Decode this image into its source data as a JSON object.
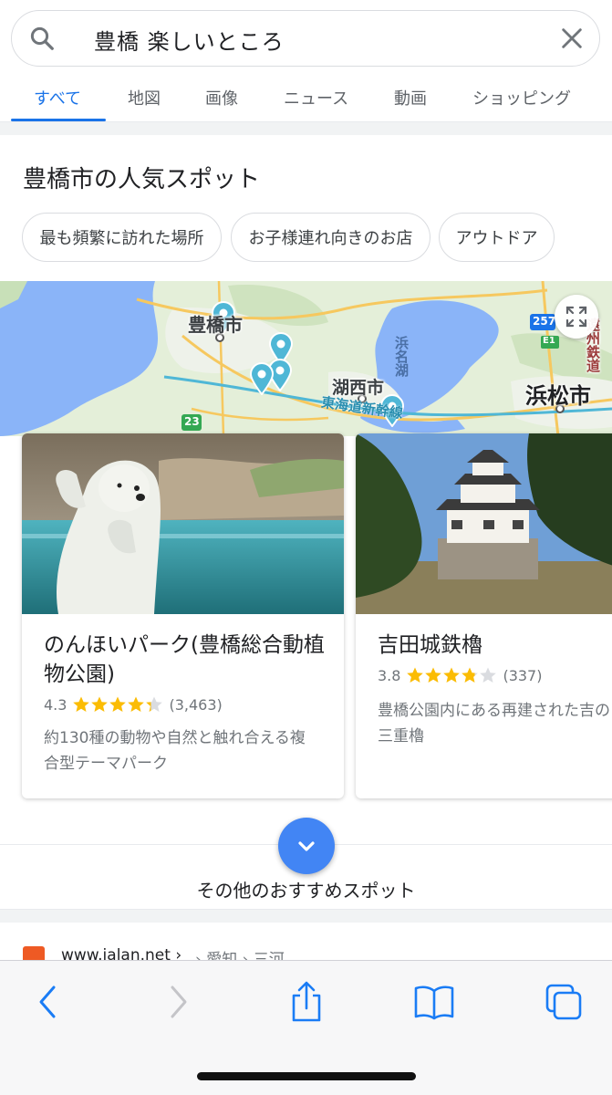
{
  "search": {
    "query": "豊橋 楽しいところ"
  },
  "tabs": [
    {
      "label": "すべて",
      "active": true
    },
    {
      "label": "地図"
    },
    {
      "label": "画像"
    },
    {
      "label": "ニュース"
    },
    {
      "label": "動画"
    },
    {
      "label": "ショッピング"
    }
  ],
  "section": {
    "title": "豊橋市の人気スポット",
    "chips": [
      "最も頻繁に訪れた場所",
      "お子様連れ向きのお店",
      "アウトドア"
    ]
  },
  "map": {
    "labels": {
      "toyohashi": "豊橋市",
      "kosai": "湖西市",
      "hamamatsu": "浜松市",
      "hamanako": "浜名湖",
      "shinkansen": "東海道新幹線",
      "route23": "23",
      "route257": "257",
      "e1": "E1",
      "ensyu": "遠州鉄道"
    }
  },
  "cards": [
    {
      "name": "のんほいパーク(豊橋総合動植物公園)",
      "rating": "4.3",
      "stars": 4.3,
      "reviews": "(3,463)",
      "description": "約130種の動物や自然と触れ合える複合型テーマパーク"
    },
    {
      "name": "吉田城鉄櫓",
      "rating": "3.8",
      "stars": 3.8,
      "reviews": "(337)",
      "description": "豊橋公園内にある再建された吉の三重櫓"
    }
  ],
  "more": {
    "label": "その他のおすすめスポット"
  },
  "result": {
    "site": "www.jalan.net ›",
    "breadcrumb": "› 愛知 › 三河"
  },
  "colors": {
    "accent": "#1a73e8",
    "star": "#fbbc04",
    "more_button": "#4285f4",
    "pin": "#4fb7d6"
  }
}
